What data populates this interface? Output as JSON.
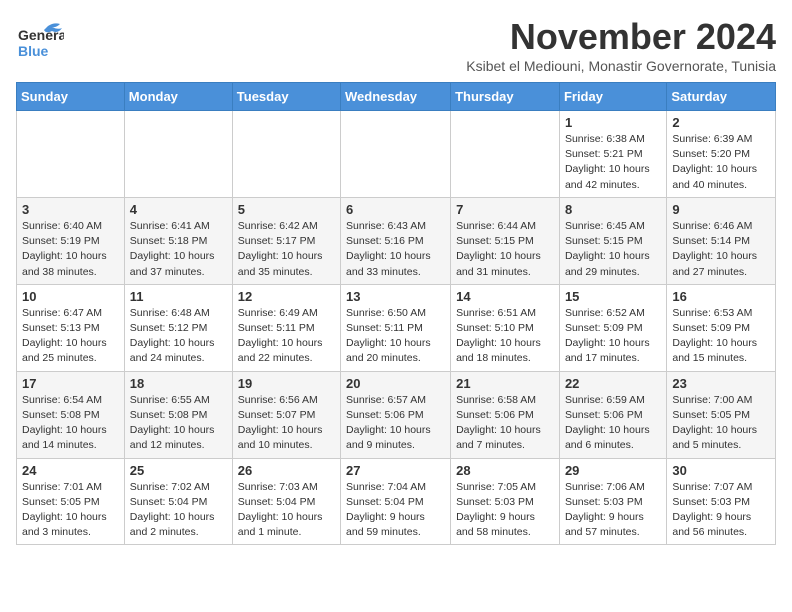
{
  "header": {
    "logo_general": "General",
    "logo_blue": "Blue",
    "month": "November 2024",
    "location": "Ksibet el Mediouni, Monastir Governorate, Tunisia"
  },
  "days_of_week": [
    "Sunday",
    "Monday",
    "Tuesday",
    "Wednesday",
    "Thursday",
    "Friday",
    "Saturday"
  ],
  "weeks": [
    [
      {
        "day": "",
        "info": ""
      },
      {
        "day": "",
        "info": ""
      },
      {
        "day": "",
        "info": ""
      },
      {
        "day": "",
        "info": ""
      },
      {
        "day": "",
        "info": ""
      },
      {
        "day": "1",
        "info": "Sunrise: 6:38 AM\nSunset: 5:21 PM\nDaylight: 10 hours and 42 minutes."
      },
      {
        "day": "2",
        "info": "Sunrise: 6:39 AM\nSunset: 5:20 PM\nDaylight: 10 hours and 40 minutes."
      }
    ],
    [
      {
        "day": "3",
        "info": "Sunrise: 6:40 AM\nSunset: 5:19 PM\nDaylight: 10 hours and 38 minutes."
      },
      {
        "day": "4",
        "info": "Sunrise: 6:41 AM\nSunset: 5:18 PM\nDaylight: 10 hours and 37 minutes."
      },
      {
        "day": "5",
        "info": "Sunrise: 6:42 AM\nSunset: 5:17 PM\nDaylight: 10 hours and 35 minutes."
      },
      {
        "day": "6",
        "info": "Sunrise: 6:43 AM\nSunset: 5:16 PM\nDaylight: 10 hours and 33 minutes."
      },
      {
        "day": "7",
        "info": "Sunrise: 6:44 AM\nSunset: 5:15 PM\nDaylight: 10 hours and 31 minutes."
      },
      {
        "day": "8",
        "info": "Sunrise: 6:45 AM\nSunset: 5:15 PM\nDaylight: 10 hours and 29 minutes."
      },
      {
        "day": "9",
        "info": "Sunrise: 6:46 AM\nSunset: 5:14 PM\nDaylight: 10 hours and 27 minutes."
      }
    ],
    [
      {
        "day": "10",
        "info": "Sunrise: 6:47 AM\nSunset: 5:13 PM\nDaylight: 10 hours and 25 minutes."
      },
      {
        "day": "11",
        "info": "Sunrise: 6:48 AM\nSunset: 5:12 PM\nDaylight: 10 hours and 24 minutes."
      },
      {
        "day": "12",
        "info": "Sunrise: 6:49 AM\nSunset: 5:11 PM\nDaylight: 10 hours and 22 minutes."
      },
      {
        "day": "13",
        "info": "Sunrise: 6:50 AM\nSunset: 5:11 PM\nDaylight: 10 hours and 20 minutes."
      },
      {
        "day": "14",
        "info": "Sunrise: 6:51 AM\nSunset: 5:10 PM\nDaylight: 10 hours and 18 minutes."
      },
      {
        "day": "15",
        "info": "Sunrise: 6:52 AM\nSunset: 5:09 PM\nDaylight: 10 hours and 17 minutes."
      },
      {
        "day": "16",
        "info": "Sunrise: 6:53 AM\nSunset: 5:09 PM\nDaylight: 10 hours and 15 minutes."
      }
    ],
    [
      {
        "day": "17",
        "info": "Sunrise: 6:54 AM\nSunset: 5:08 PM\nDaylight: 10 hours and 14 minutes."
      },
      {
        "day": "18",
        "info": "Sunrise: 6:55 AM\nSunset: 5:08 PM\nDaylight: 10 hours and 12 minutes."
      },
      {
        "day": "19",
        "info": "Sunrise: 6:56 AM\nSunset: 5:07 PM\nDaylight: 10 hours and 10 minutes."
      },
      {
        "day": "20",
        "info": "Sunrise: 6:57 AM\nSunset: 5:06 PM\nDaylight: 10 hours and 9 minutes."
      },
      {
        "day": "21",
        "info": "Sunrise: 6:58 AM\nSunset: 5:06 PM\nDaylight: 10 hours and 7 minutes."
      },
      {
        "day": "22",
        "info": "Sunrise: 6:59 AM\nSunset: 5:06 PM\nDaylight: 10 hours and 6 minutes."
      },
      {
        "day": "23",
        "info": "Sunrise: 7:00 AM\nSunset: 5:05 PM\nDaylight: 10 hours and 5 minutes."
      }
    ],
    [
      {
        "day": "24",
        "info": "Sunrise: 7:01 AM\nSunset: 5:05 PM\nDaylight: 10 hours and 3 minutes."
      },
      {
        "day": "25",
        "info": "Sunrise: 7:02 AM\nSunset: 5:04 PM\nDaylight: 10 hours and 2 minutes."
      },
      {
        "day": "26",
        "info": "Sunrise: 7:03 AM\nSunset: 5:04 PM\nDaylight: 10 hours and 1 minute."
      },
      {
        "day": "27",
        "info": "Sunrise: 7:04 AM\nSunset: 5:04 PM\nDaylight: 9 hours and 59 minutes."
      },
      {
        "day": "28",
        "info": "Sunrise: 7:05 AM\nSunset: 5:03 PM\nDaylight: 9 hours and 58 minutes."
      },
      {
        "day": "29",
        "info": "Sunrise: 7:06 AM\nSunset: 5:03 PM\nDaylight: 9 hours and 57 minutes."
      },
      {
        "day": "30",
        "info": "Sunrise: 7:07 AM\nSunset: 5:03 PM\nDaylight: 9 hours and 56 minutes."
      }
    ]
  ]
}
